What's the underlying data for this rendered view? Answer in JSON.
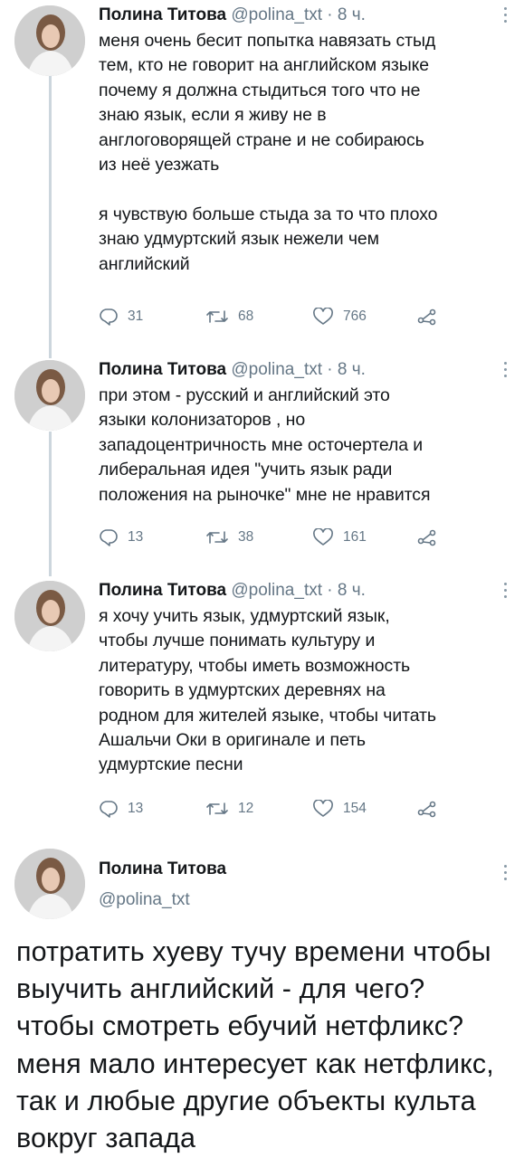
{
  "tweets": [
    {
      "name": "Полина Титова",
      "handle": "@polina_txt",
      "sep": "·",
      "time": "8 ч.",
      "text": "меня очень бесит попытка навязать стыд\nтем, кто не говорит на английском языке\nпочему я должна стыдиться того что не\nзнаю язык, если я живу не в\nанглоговорящей стране и не собираюсь\nиз неё уезжать\n\nя чувствую больше стыда за то что плохо\nзнаю удмуртский язык нежели чем\nанглийский",
      "replies": "31",
      "retweets": "68",
      "likes": "766"
    },
    {
      "name": "Полина Титова",
      "handle": "@polina_txt",
      "sep": "·",
      "time": "8 ч.",
      "text": "при этом - русский и английский это\nязыки колонизаторов , но\nзападоцентричность мне осточертела и\nлиберальная идея \"учить язык ради\nположения на рыночке\" мне не нравится",
      "replies": "13",
      "retweets": "38",
      "likes": "161"
    },
    {
      "name": "Полина Титова",
      "handle": "@polina_txt",
      "sep": "·",
      "time": "8 ч.",
      "text": "я хочу учить язык, удмуртский язык,\nчтобы лучше понимать культуру и\nлитературу, чтобы иметь возможность\nговорить в удмуртских деревнях на\nродном для жителей языке, чтобы читать\nАшальчи Оки в оригинале и петь\nудмуртские песни",
      "replies": "13",
      "retweets": "12",
      "likes": "154"
    }
  ],
  "main_tweet": {
    "name": "Полина Титова",
    "handle": "@polina_txt",
    "text": "потратить хуеву тучу времени чтобы выучить английский - для чего? чтобы смотреть ебучий нетфликс? меня мало интересует как нетфликс, так и любые другие объекты культа вокруг запада"
  },
  "icons": {
    "reply": "reply-icon",
    "retweet": "retweet-icon",
    "like": "heart-icon",
    "share": "share-icon",
    "menu": "more-vertical-icon"
  },
  "colors": {
    "text": "#14171a",
    "muted": "#657786",
    "thread_line": "#ccd6dd"
  }
}
